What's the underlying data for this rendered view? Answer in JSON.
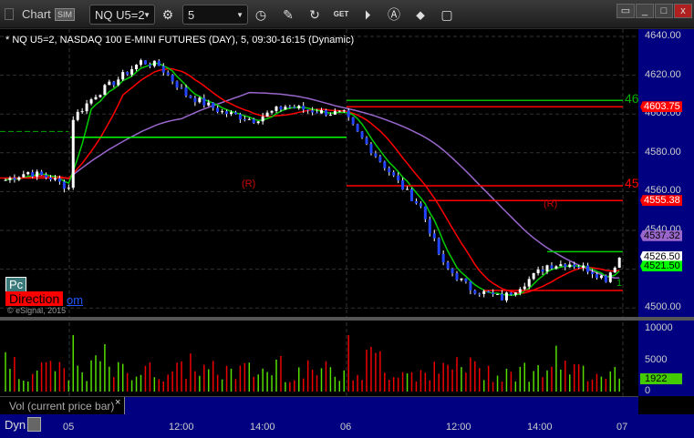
{
  "titlebar": {
    "title": "Chart",
    "sim": "SIM",
    "symbol": "NQ U5=2",
    "interval": "5",
    "icons": [
      "gear-icon",
      "clock-icon",
      "pencil-icon",
      "refresh-icon",
      "get-icon",
      "play-icon",
      "alert-icon",
      "link-icon",
      "note-icon"
    ],
    "window_buttons": [
      "restore",
      "minimize",
      "maximize",
      "close"
    ]
  },
  "chart": {
    "header": "* NQ U5=2, NASDAQ 100 E-MINI FUTURES (DAY), 5, 09:30-16:15 (Dynamic)",
    "pc": "Pc",
    "direction": "Direction",
    "om": "om",
    "copyright": "© eSignal, 2015",
    "marker_46": "46",
    "marker_45": "45",
    "r_label": "(R)",
    "marker_1": "1"
  },
  "price_axis": {
    "ticks": [
      "4640.00",
      "4620.00",
      "4600.00",
      "4580.00",
      "4560.00",
      "4540.00",
      "4520.00",
      "4500.00"
    ],
    "tags": [
      {
        "value": "4603.75",
        "color": "#ff0000",
        "text": "#ffffff"
      },
      {
        "value": "4555.38",
        "color": "#ff0000",
        "text": "#ffffff"
      },
      {
        "value": "4537.32",
        "color": "#9966cc",
        "text": "#000000"
      },
      {
        "value": "4526.50",
        "color": "#ffffff",
        "text": "#000000"
      },
      {
        "value": "4521.50",
        "color": "#00ff00",
        "text": "#000000"
      }
    ]
  },
  "volume": {
    "label": "Vol (current price bar)",
    "ticks": [
      "10000",
      "5000",
      "0"
    ],
    "current": "1922",
    "close": "×"
  },
  "time_axis": {
    "dyn": "Dyn",
    "ticks": [
      "05",
      "12:00",
      "14:00",
      "06",
      "12:00",
      "14:00",
      "07"
    ]
  },
  "chart_data": {
    "type": "candlestick",
    "ylim": [
      4497,
      4643
    ],
    "close_keypoints": [
      [
        0,
        4566
      ],
      [
        5,
        4570
      ],
      [
        10,
        4567
      ],
      [
        14,
        4562
      ],
      [
        15,
        4598
      ],
      [
        20,
        4610
      ],
      [
        25,
        4618
      ],
      [
        30,
        4627
      ],
      [
        34,
        4625
      ],
      [
        40,
        4610
      ],
      [
        48,
        4601
      ],
      [
        55,
        4597
      ],
      [
        62,
        4604
      ],
      [
        70,
        4601
      ],
      [
        75,
        4600
      ],
      [
        78,
        4590
      ],
      [
        83,
        4576
      ],
      [
        88,
        4562
      ],
      [
        92,
        4552
      ],
      [
        97,
        4522
      ],
      [
        103,
        4510
      ],
      [
        110,
        4505
      ],
      [
        115,
        4513
      ],
      [
        120,
        4522
      ],
      [
        125,
        4523
      ],
      [
        129,
        4520
      ],
      [
        133,
        4515
      ],
      [
        136,
        4526
      ]
    ],
    "levels": [
      {
        "price": 4607,
        "color": "#00c000",
        "label": "46"
      },
      {
        "price": 4603.75,
        "color": "#ff0000"
      },
      {
        "price": 4563,
        "color": "#ff0000",
        "label": "45"
      },
      {
        "price": 4555,
        "color": "#ff0000"
      },
      {
        "price": 4588,
        "color": "#00ff00"
      }
    ],
    "volume_max": 10000
  }
}
